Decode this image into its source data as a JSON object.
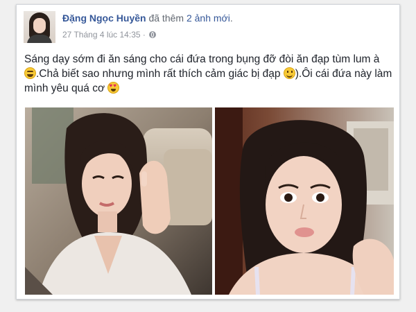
{
  "post": {
    "author": "Đặng Ngọc Huyền",
    "action": "đã thêm",
    "photos_added": "2 ảnh mới",
    "timestamp": "27 Tháng 4 lúc 14:35",
    "separator": "·",
    "privacy_icon": "globe-icon",
    "text_1": "Sáng dạy sớm đi ăn sáng cho cái đứa trong bụng đỡ đòi ăn đạp tùm lum à",
    "text_2": ".Chả biết sao nhưng mình rất thích cảm giác bị đạp",
    "text_3": ").Ôi cái đứa này làm mình yêu quá cơ",
    "emojis": [
      "laughing-emoji",
      "smile-emoji",
      "heart-eyes-emoji"
    ]
  },
  "colors": {
    "author_link": "#365899",
    "body_text": "#1d2129",
    "meta_text": "#90949c"
  },
  "photos": [
    {
      "name": "selfie-in-car-left"
    },
    {
      "name": "selfie-in-car-right"
    }
  ]
}
